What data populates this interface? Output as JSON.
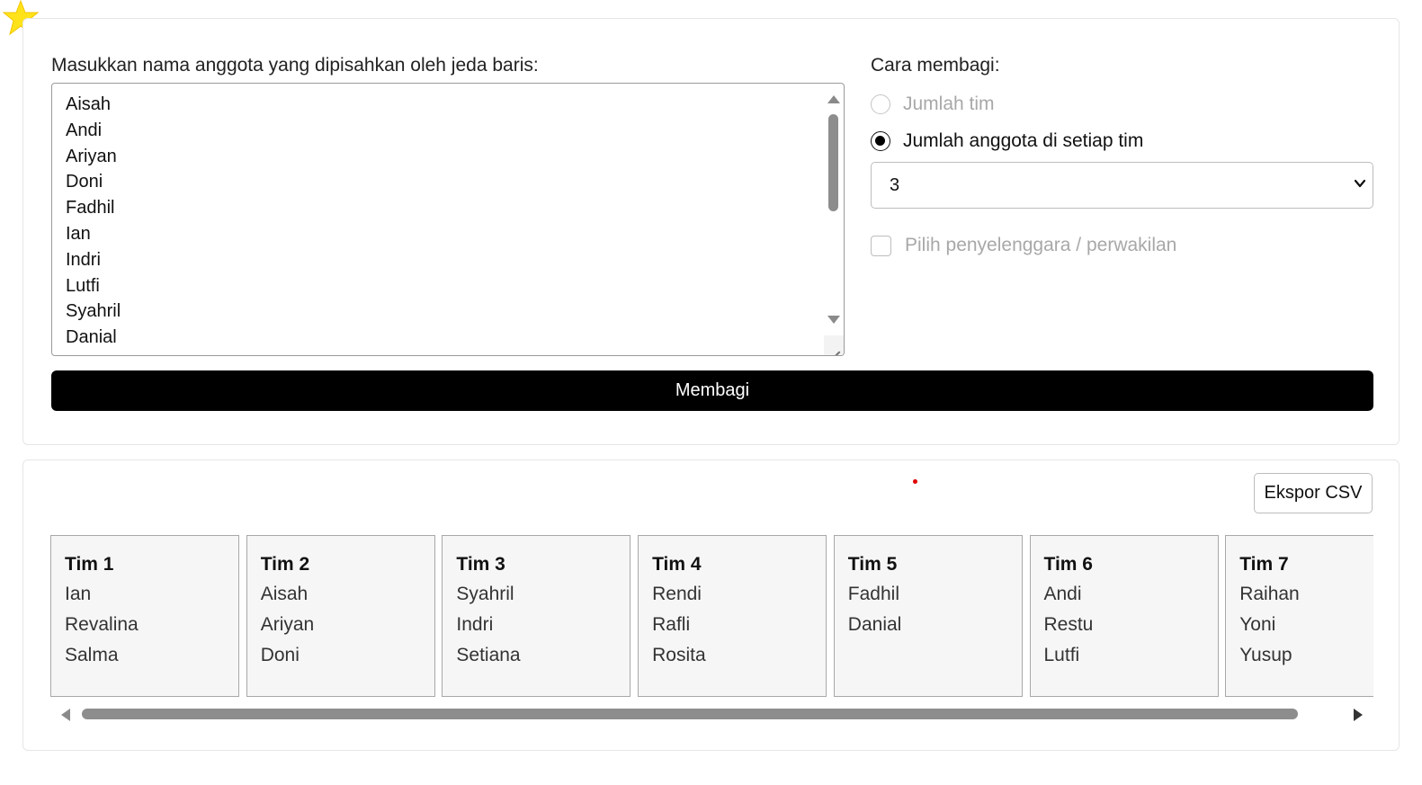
{
  "colors": {
    "star": "#FFE31A",
    "primary_button": "#000000",
    "accent_dot": "#E00000"
  },
  "form": {
    "members_label": "Masukkan nama anggota yang dipisahkan oleh jeda baris:",
    "members_lines": [
      "Aisah",
      "Andi",
      "Ariyan",
      "Doni",
      "Fadhil",
      "Ian",
      "Indri",
      "Lutfi",
      "Syahril",
      "Danial"
    ],
    "method_label": "Cara membagi:",
    "option_team_count": "Jumlah tim",
    "option_members_per_team": "Jumlah anggota di setiap tim",
    "selected_option": "Jumlah anggota di setiap tim",
    "members_per_team_value": "3",
    "organizer_checkbox_label": "Pilih penyelenggara / perwakilan",
    "submit_label": "Membagi"
  },
  "results": {
    "export_label": "Ekspor CSV",
    "teams": [
      {
        "name": "Tim 1",
        "members": [
          "Ian",
          "Revalina",
          "Salma"
        ]
      },
      {
        "name": "Tim 2",
        "members": [
          "Aisah",
          "Ariyan",
          "Doni"
        ]
      },
      {
        "name": "Tim 3",
        "members": [
          "Syahril",
          "Indri",
          "Setiana"
        ]
      },
      {
        "name": "Tim 4",
        "members": [
          "Rendi",
          "Rafli",
          "Rosita"
        ]
      },
      {
        "name": "Tim 5",
        "members": [
          "Fadhil",
          "Danial"
        ]
      },
      {
        "name": "Tim 6",
        "members": [
          "Andi",
          "Restu",
          "Lutfi"
        ]
      },
      {
        "name": "Tim 7",
        "members": [
          "Raihan",
          "Yoni",
          "Yusup"
        ]
      }
    ]
  },
  "icons": {
    "star": "star-icon",
    "select_chevron": "chevron-down-icon",
    "scroll_left": "arrow-left-icon",
    "scroll_right": "arrow-right-icon"
  }
}
